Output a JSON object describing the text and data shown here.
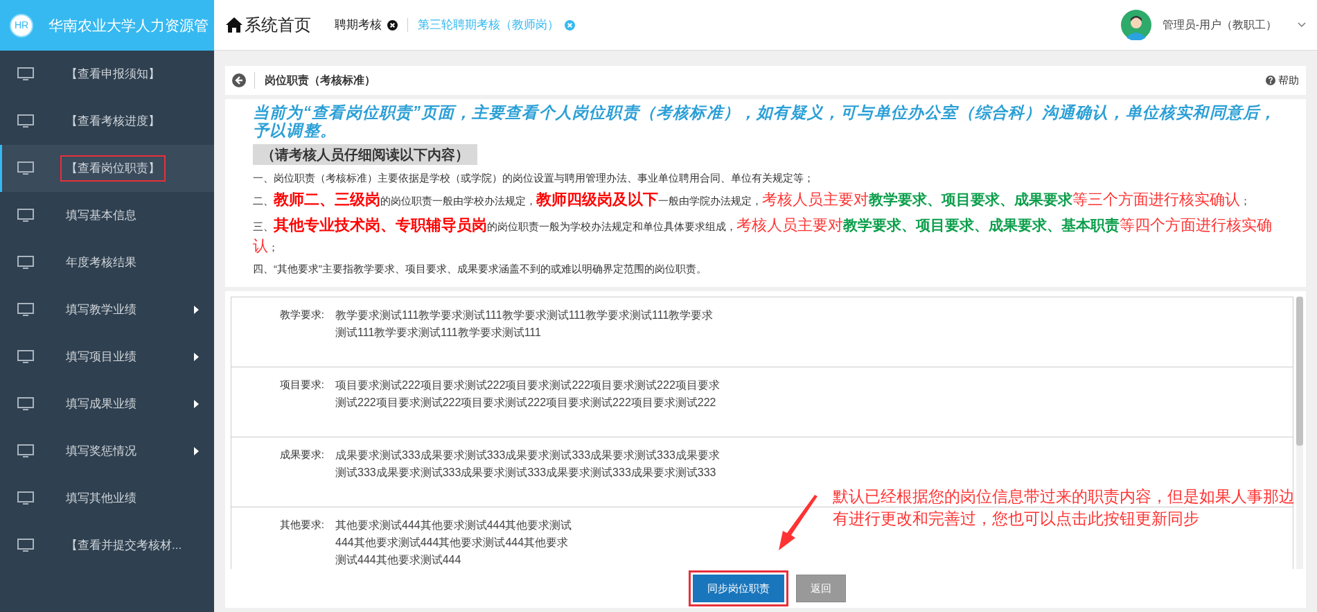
{
  "header": {
    "logo": "HR",
    "app_title": "华南农业大学人力资源管",
    "home": "系统首页",
    "tabs": [
      {
        "label": "聘期考核",
        "selected": false
      },
      {
        "label": "第三轮聘期考核（教师岗）",
        "selected": true
      }
    ],
    "user": "管理员-用户（教职工）"
  },
  "sidebar": {
    "items": [
      {
        "label": "【查看申报须知】",
        "selected": false,
        "highlighted": false,
        "has_children": false
      },
      {
        "label": "【查看考核进度】",
        "selected": false,
        "highlighted": false,
        "has_children": false
      },
      {
        "label": "【查看岗位职责】",
        "selected": true,
        "highlighted": true,
        "has_children": false
      },
      {
        "label": "填写基本信息",
        "selected": false,
        "highlighted": false,
        "has_children": false
      },
      {
        "label": "年度考核结果",
        "selected": false,
        "highlighted": false,
        "has_children": false
      },
      {
        "label": "填写教学业绩",
        "selected": false,
        "highlighted": false,
        "has_children": true
      },
      {
        "label": "填写项目业绩",
        "selected": false,
        "highlighted": false,
        "has_children": true
      },
      {
        "label": "填写成果业绩",
        "selected": false,
        "highlighted": false,
        "has_children": true
      },
      {
        "label": "填写奖惩情况",
        "selected": false,
        "highlighted": false,
        "has_children": true
      },
      {
        "label": "填写其他业绩",
        "selected": false,
        "highlighted": false,
        "has_children": false
      },
      {
        "label": "【查看并提交考核材...",
        "selected": false,
        "highlighted": false,
        "has_children": false
      }
    ]
  },
  "page": {
    "title": "岗位职责（考核标准）",
    "help": "帮助"
  },
  "notice": {
    "headline": "当前为“查看岗位职责”页面，主要查看个人岗位职责（考核标准），如有疑义，可与单位办公室（综合科）沟通确认，单位核实和同意后，予以调整。",
    "subheading": "（请考核人员仔细阅读以下内容）",
    "paragraphs": [
      [
        {
          "kind": "plain",
          "text": "一、岗位职责（考核标准）主要依据是学校（或学院）的岗位设置与聘用管理办法、事业单位聘用合同、单位有关规定等；"
        }
      ],
      [
        {
          "kind": "plain",
          "text": "二、"
        },
        {
          "kind": "red_bold",
          "text": "教师二、三级岗"
        },
        {
          "kind": "plain",
          "text": "的岗位职责一般由学校办法规定，"
        },
        {
          "kind": "red_bold",
          "text": "教师四级岗及以下"
        },
        {
          "kind": "plain",
          "text": "一般由学院办法规定，"
        },
        {
          "kind": "red",
          "text": "考核人员主要对"
        },
        {
          "kind": "green_bold",
          "text": "教学要求、项目要求、成果要求"
        },
        {
          "kind": "red",
          "text": "等三个方面进行核实确认"
        },
        {
          "kind": "plain",
          "text": "；"
        }
      ],
      [
        {
          "kind": "plain",
          "text": "三、"
        },
        {
          "kind": "red_bold",
          "text": "其他专业技术岗、专职辅导员岗"
        },
        {
          "kind": "plain",
          "text": "的岗位职责一般为学校办法规定和单位具体要求组成，"
        },
        {
          "kind": "red",
          "text": "考核人员主要对"
        },
        {
          "kind": "green_bold",
          "text": "教学要求、项目要求、成果要求、基本职责"
        },
        {
          "kind": "red",
          "text": "等四个方面进行核实确认"
        },
        {
          "kind": "plain",
          "text": "；"
        }
      ],
      [
        {
          "kind": "plain",
          "text": "四、“其他要求”主要指教学要求、项目要求、成果要求涵盖不到的或难以明确界定范围的岗位职责。"
        }
      ]
    ]
  },
  "requirements": [
    {
      "label": "教学要求:",
      "lines": [
        "教学要求测试111教学要求测试111教学要求测试111教学要求测试111教学要求",
        "测试111教学要求测试111教学要求测试111"
      ]
    },
    {
      "label": "项目要求:",
      "lines": [
        "项目要求测试222项目要求测试222项目要求测试222项目要求测试222项目要求",
        "测试222项目要求测试222项目要求测试222项目要求测试222项目要求测试222"
      ]
    },
    {
      "label": "成果要求:",
      "lines": [
        "成果要求测试333成果要求测试333成果要求测试333成果要求测试333成果要求",
        "测试333成果要求测试333成果要求测试333成果要求测试333成果要求测试333"
      ]
    },
    {
      "label": "其他要求:",
      "lines": [
        "其他要求测试444其他要求测试444其他要求测试",
        "444其他要求测试444其他要求测试444其他要求",
        "测试444其他要求测试444"
      ]
    }
  ],
  "buttons": [
    {
      "label": "同步岗位职责",
      "kind": "primary",
      "highlighted": true
    },
    {
      "label": "返回",
      "kind": "secondary",
      "highlighted": false
    }
  ],
  "annotation": "默认已经根据您的岗位信息带过来的职责内容，但是如果人事那边有进行更改和完善过，您也可以点击此按钮更新同步"
}
